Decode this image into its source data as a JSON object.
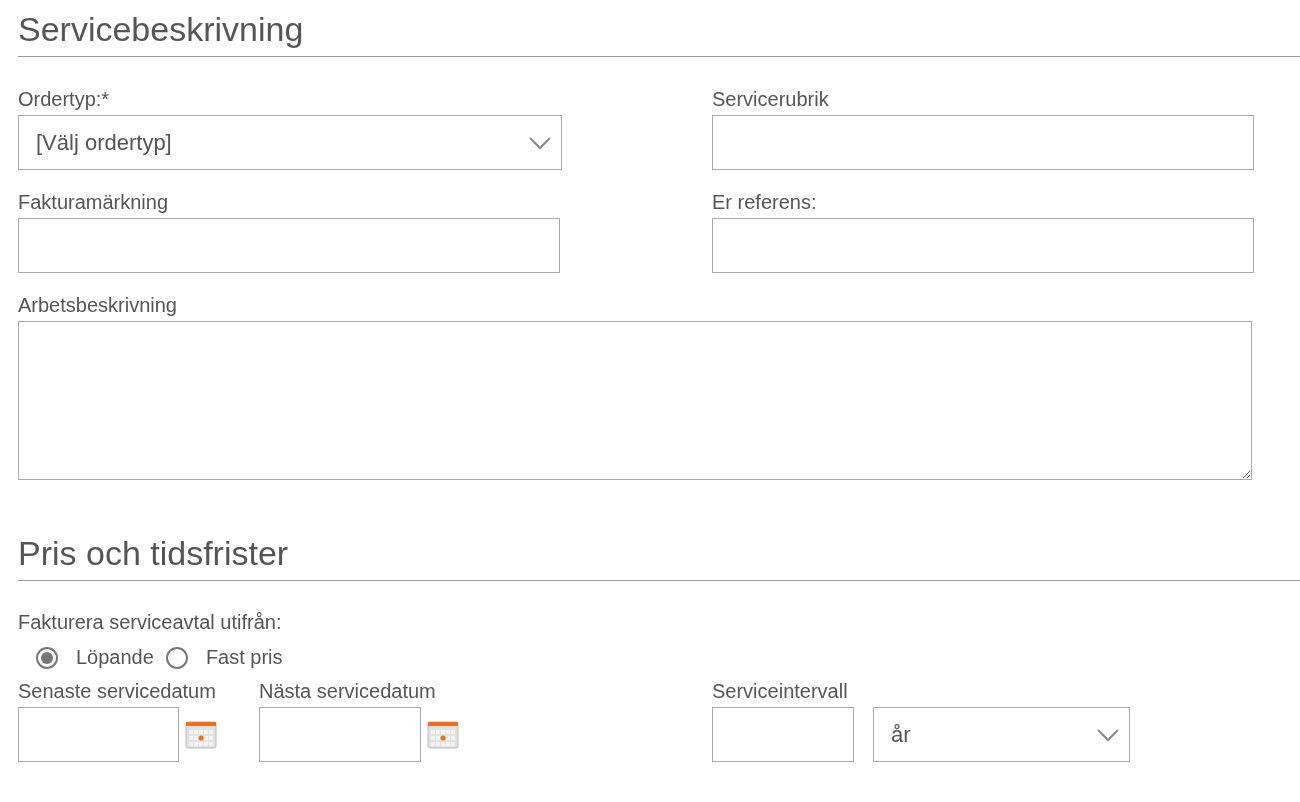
{
  "sections": [
    {
      "title": "Servicebeskrivning"
    },
    {
      "title": "Pris och tidsfrister"
    }
  ],
  "description": {
    "order_type": {
      "label": "Ordertyp:*",
      "value": "[Välj ordertyp]"
    },
    "service_heading": {
      "label": "Servicerubrik"
    },
    "invoice_marking": {
      "label": "Fakturamärkning"
    },
    "your_reference": {
      "label": "Er referens:"
    },
    "work_description": {
      "label": "Arbetsbeskrivning"
    }
  },
  "pricing": {
    "billing_label": "Fakturera serviceavtal utifrån:",
    "billing_options": [
      {
        "label": "Löpande",
        "selected": true
      },
      {
        "label": "Fast pris",
        "selected": false
      }
    ],
    "last_service_date": {
      "label": "Senaste servicedatum"
    },
    "next_service_date": {
      "label": "Nästa servicedatum"
    },
    "service_interval": {
      "label": "Serviceintervall",
      "unit": "år"
    }
  }
}
